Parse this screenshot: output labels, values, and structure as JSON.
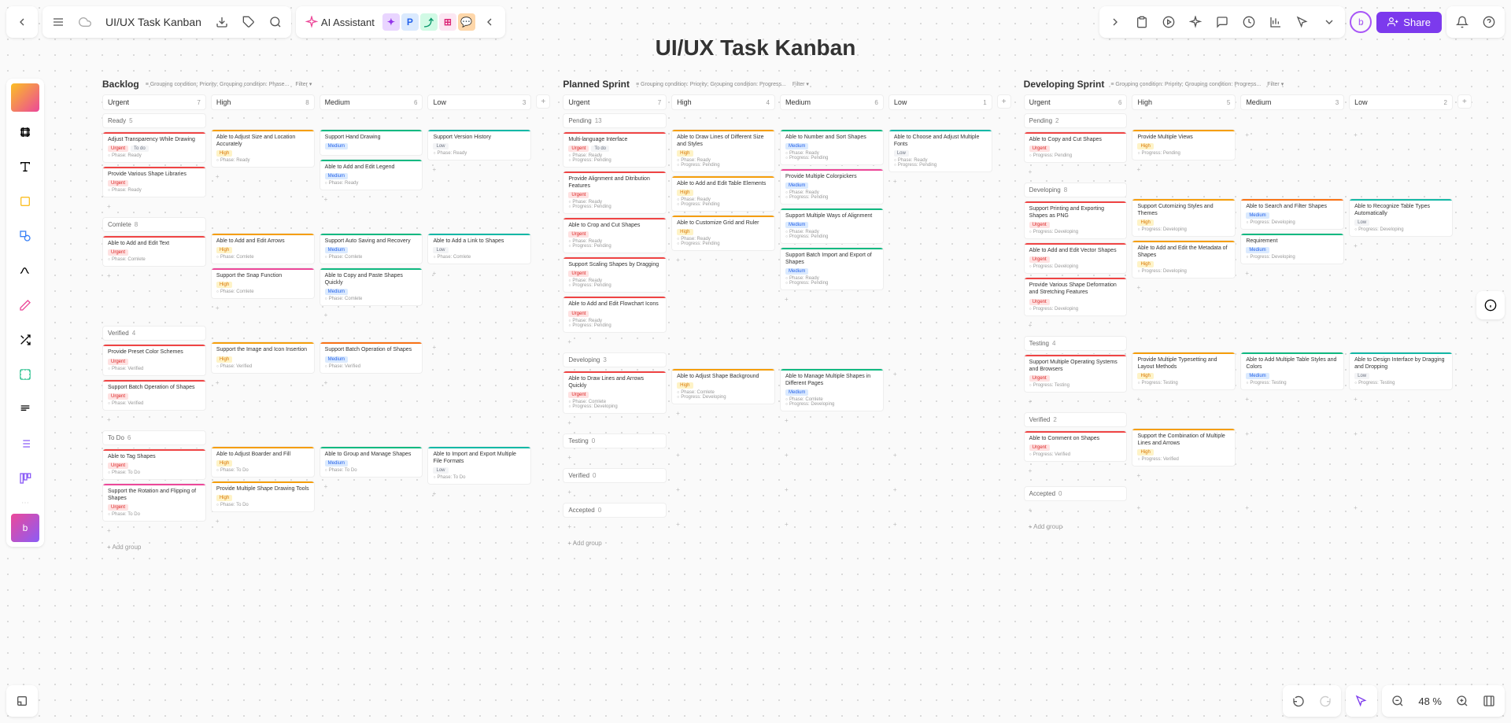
{
  "doc": {
    "title": "UI/UX Task Kanban",
    "board_title": "UI/UX Task Kanban",
    "ai_label": "AI Assistant"
  },
  "topbar": {
    "share": "Share"
  },
  "zoom": "48 %",
  "boards": [
    {
      "name": "Backlog",
      "sub": "Grouping condition: Priority; Grouping condition: Phase...",
      "filter": "Filter",
      "columns": [
        "Urgent",
        "High",
        "Medium",
        "Low"
      ],
      "counts": [
        "7",
        "8",
        "6",
        "3"
      ]
    },
    {
      "name": "Planned Sprint",
      "sub": "Grouping condition: Priority; Grouping condition: Progress...",
      "filter": "Filter",
      "columns": [
        "Urgent",
        "High",
        "Medium",
        "Low"
      ],
      "counts": [
        "7",
        "4",
        "6",
        "1"
      ]
    },
    {
      "name": "Developing Sprint",
      "sub": "Grouping condition: Priority; Grouping condition: Progress...",
      "filter": "Filter",
      "columns": [
        "Urgent",
        "High",
        "Medium",
        "Low"
      ],
      "counts": [
        "6",
        "5",
        "3",
        "2"
      ]
    }
  ],
  "groups": {
    "ready": "Ready",
    "complete": "Comlete",
    "verified": "Verified",
    "todo": "To Do",
    "pending": "Pending",
    "developing": "Developing",
    "testing": "Testing",
    "accepted": "Accepted",
    "addgroup": "Add group"
  },
  "cards": {
    "b1": {
      "ready": [
        [
          {
            "t": "Adjust Transparency While Drawing",
            "tags": [
              "Urgent",
              "To do"
            ],
            "m": "Phase: Ready",
            "bar": "red"
          }
        ],
        [
          {
            "t": "Able to Adjust Size and Location Accurately",
            "tags": [
              "High"
            ],
            "m": "Phase: Ready",
            "bar": "yellow"
          }
        ],
        [
          {
            "t": "Support Hand Drawing",
            "tags": [
              "Medium"
            ],
            "m": "",
            "bar": "green"
          },
          {
            "t": "Able to Add and Edit Legend",
            "tags": [
              "Medium"
            ],
            "m": "Phase: Ready",
            "bar": "green"
          }
        ],
        [
          {
            "t": "Support Version History",
            "tags": [
              "Low"
            ],
            "m": "Phase: Ready",
            "bar": "teal"
          }
        ]
      ],
      "ready_n": "5",
      "complete": [
        [
          {
            "t": "Able to Add and Edit Text",
            "tags": [
              "Urgent"
            ],
            "m": "Phase: Comlete",
            "bar": "red"
          }
        ],
        [
          {
            "t": "Able to Add and Edit Arrows",
            "tags": [
              "High"
            ],
            "m": "Phase: Comlete",
            "bar": "yellow"
          },
          {
            "t": "Support the Snap Function",
            "tags": [
              "High"
            ],
            "m": "Phase: Comlete",
            "bar": "pink"
          }
        ],
        [
          {
            "t": "Support Auto Saving and Recovery",
            "tags": [
              "Medium"
            ],
            "m": "Phase: Comlete",
            "bar": "green"
          },
          {
            "t": "Able to Copy and Paste Shapes Quickly",
            "tags": [
              "Medium"
            ],
            "m": "Phase: Comlete",
            "bar": "green"
          }
        ],
        [
          {
            "t": "Able to Add a Link to Shapes",
            "tags": [
              "Low"
            ],
            "m": "Phase: Comlete",
            "bar": "teal"
          }
        ]
      ],
      "complete_n": "8",
      "verified": [
        [
          {
            "t": "Provide Preset Color Schemes",
            "tags": [
              "Urgent"
            ],
            "m": "Phase: Verified",
            "bar": "red"
          },
          {
            "t": "Support Batch Operation of Shapes",
            "tags": [
              "Urgent"
            ],
            "m": "Phase: Verified",
            "bar": "red"
          }
        ],
        [
          {
            "t": "Support the Image and Icon Insertion",
            "tags": [
              "High"
            ],
            "m": "Phase: Verified",
            "bar": "yellow"
          }
        ],
        [
          {
            "t": "Support Batch Operation of Shapes",
            "tags": [
              "Medium"
            ],
            "m": "Phase: Verified",
            "bar": "orange"
          }
        ],
        []
      ],
      "verified_n": "4",
      "todo": [
        [
          {
            "t": "Able to Tag Shapes",
            "tags": [
              "Urgent"
            ],
            "m": "Phase: To Do",
            "bar": "red"
          },
          {
            "t": "Support the Rotation and Flipping of Shapes",
            "tags": [
              "Urgent"
            ],
            "m": "Phase: To Do",
            "bar": "pink"
          }
        ],
        [
          {
            "t": "Able to Adjust Boarder and Fill",
            "tags": [
              "High"
            ],
            "m": "Phase: To Do",
            "bar": "yellow"
          },
          {
            "t": "Provide Multiple Shape Drawing Tools",
            "tags": [
              "High"
            ],
            "m": "Phase: To Do",
            "bar": "yellow"
          }
        ],
        [
          {
            "t": "Able to Group and Manage Shapes",
            "tags": [
              "Medium"
            ],
            "m": "Phase: To Do",
            "bar": "green"
          }
        ],
        [
          {
            "t": "Able to Import and Export Multiple File Formats",
            "tags": [
              "Low"
            ],
            "m": "Phase: To Do",
            "bar": "teal"
          }
        ]
      ],
      "todo_n": "6",
      "extra_ready": [
        {
          "t": "Provide Various Shape Libraries",
          "tags": [
            "Urgent"
          ],
          "m": "Phase: Ready",
          "bar": "red"
        }
      ]
    },
    "b2": {
      "pending": [
        [
          {
            "t": "Multi-language Interface",
            "tags": [
              "Urgent",
              "To do"
            ],
            "m": "Phase: Ready",
            "m2": "Progress: Pending",
            "bar": "red"
          },
          {
            "t": "Provide Alignment and Ditribution Features",
            "tags": [
              "Urgent"
            ],
            "m": "Phase: Ready",
            "m2": "Progress: Pending",
            "bar": "red"
          },
          {
            "t": "Able to Crop and Cut Shapes",
            "tags": [
              "Urgent"
            ],
            "m": "Phase: Ready",
            "m2": "Progress: Pending",
            "bar": "red"
          },
          {
            "t": "Support Scaling Shapes by Dragging",
            "tags": [
              "Urgent"
            ],
            "m": "Phase: Ready",
            "m2": "Progress: Pending",
            "bar": "red"
          },
          {
            "t": "Able to Add and Edit Flowchart Icons",
            "tags": [
              "Urgent"
            ],
            "m": "Phase: Ready",
            "m2": "Progress: Pending",
            "bar": "red"
          }
        ],
        [
          {
            "t": "Able to Draw Lines of Different Size and Styles",
            "tags": [
              "High"
            ],
            "m": "Phase: Ready",
            "m2": "Progress: Pending",
            "bar": "yellow"
          },
          {
            "t": "Able to Add and Edit Table Elements",
            "tags": [
              "High"
            ],
            "m": "Phase: Ready",
            "m2": "Progress: Pending",
            "bar": "yellow"
          },
          {
            "t": "Able to Customize Grid and Ruler",
            "tags": [
              "High"
            ],
            "m": "Phase: Ready",
            "m2": "Progress: Pending",
            "bar": "yellow"
          }
        ],
        [
          {
            "t": "Able to Number and Sort Shapes",
            "tags": [
              "Medium"
            ],
            "m": "Phase: Ready",
            "m2": "Progress: Pending",
            "bar": "green"
          },
          {
            "t": "Provide Multiple Colorpickers",
            "tags": [
              "Medium"
            ],
            "m": "Phase: Ready",
            "m2": "Progress: Pending",
            "bar": "pink"
          },
          {
            "t": "Support Multiple Ways of Alignment",
            "tags": [
              "Medium"
            ],
            "m": "Phase: Ready",
            "m2": "Progress: Pending",
            "bar": "green"
          },
          {
            "t": "Support Batch Import and Export of Shapes",
            "tags": [
              "Medium"
            ],
            "m": "Phase: Ready",
            "m2": "Progress: Pending",
            "bar": "green"
          }
        ],
        [
          {
            "t": "Able to Choose and Adjust Multiple Fonts",
            "tags": [
              "Low"
            ],
            "m": "Phase: Ready",
            "m2": "Progress: Pending",
            "bar": "teal"
          }
        ]
      ],
      "pending_n": "13",
      "developing": [
        [
          {
            "t": "Able to Draw Lines and Arrows Quickly",
            "tags": [
              "Urgent"
            ],
            "m": "Phase: Comlete",
            "m2": "Progress: Developing",
            "bar": "red"
          }
        ],
        [
          {
            "t": "Able to Adjust Shape Background",
            "tags": [
              "High"
            ],
            "m": "Phase: Comlete",
            "m2": "Progress: Developing",
            "bar": "yellow"
          }
        ],
        [
          {
            "t": "Able to Manage Multiple Shapes in Different Pages",
            "tags": [
              "Medium"
            ],
            "m": "Phase: Comlete",
            "m2": "Progress: Developing",
            "bar": "green"
          }
        ],
        []
      ],
      "developing_n": "3",
      "testing_n": "0",
      "verified_n": "0",
      "accepted_n": "0"
    },
    "b3": {
      "pending": [
        [
          {
            "t": "Able to Copy and Cut Shapes",
            "tags": [
              "Urgent"
            ],
            "m": "Progress: Pending",
            "bar": "red"
          }
        ],
        [
          {
            "t": "Provide Multiple Views",
            "tags": [
              "High"
            ],
            "m": "Progress: Pending",
            "bar": "yellow"
          }
        ],
        [],
        []
      ],
      "pending_n": "2",
      "developing": [
        [
          {
            "t": "Support Printing and Exporting Shapes as PNG",
            "tags": [
              "Urgent"
            ],
            "m": "Progress: Developing",
            "bar": "red"
          },
          {
            "t": "Able to Add and Edit Vector Shapes",
            "tags": [
              "Urgent"
            ],
            "m": "Progress: Developing",
            "bar": "red"
          },
          {
            "t": "Provide Various Shape Deformation and Stretching Features",
            "tags": [
              "Urgent"
            ],
            "m": "Progress: Developing",
            "bar": "red"
          }
        ],
        [
          {
            "t": "Support Cutomizing Styles and Themes",
            "tags": [
              "High"
            ],
            "m": "Progress: Developing",
            "bar": "yellow"
          },
          {
            "t": "Able to Add and Edit the Metadata of Shapes",
            "tags": [
              "High"
            ],
            "m": "Progress: Developing",
            "bar": "yellow"
          }
        ],
        [
          {
            "t": "Able to Search and Filter Shapes",
            "tags": [
              "Medium"
            ],
            "m": "Progress: Developing",
            "bar": "orange"
          },
          {
            "t": "Requirement",
            "tags": [
              "Medium"
            ],
            "m": "Progress: Developing",
            "bar": "green"
          }
        ],
        [
          {
            "t": "Able to Recognize Table Types Automatically",
            "tags": [
              "Low"
            ],
            "m": "Progress: Developing",
            "bar": "teal"
          }
        ]
      ],
      "developing_n": "8",
      "testing": [
        [
          {
            "t": "Support Multiple Operating Systems and Browsers",
            "tags": [
              "Urgent"
            ],
            "m": "Progress: Testing",
            "bar": "red"
          }
        ],
        [
          {
            "t": "Provide Multiple Typesetting and Layout Methods",
            "tags": [
              "High"
            ],
            "m": "Progress: Testing",
            "bar": "yellow"
          }
        ],
        [
          {
            "t": "Able to Add Multiple Table Styles and Colors",
            "tags": [
              "Medium"
            ],
            "m": "Progress: Testing",
            "bar": "green"
          }
        ],
        [
          {
            "t": "Able to Design Interface by Dragging and Dropping",
            "tags": [
              "Low"
            ],
            "m": "Progress: Testing",
            "bar": "teal"
          }
        ]
      ],
      "testing_n": "4",
      "verified": [
        [
          {
            "t": "Able to Comment on Shapes",
            "tags": [
              "Urgent"
            ],
            "m": "Progress: Verified",
            "bar": "red"
          }
        ],
        [
          {
            "t": "Support the Combination of Multiple Lines and Arrows",
            "tags": [
              "High"
            ],
            "m": "Progress: Verified",
            "bar": "yellow"
          }
        ],
        [],
        []
      ],
      "verified_n": "2",
      "accepted_n": "0"
    }
  }
}
